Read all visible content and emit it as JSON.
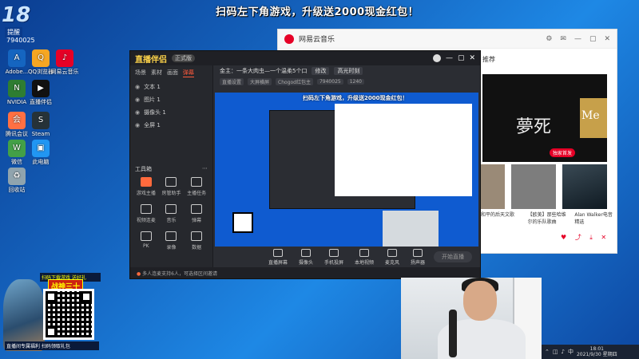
{
  "banner": "扫码左下角游戏，升级送2000现金红包！",
  "streamer": {
    "logo_text": "18",
    "sub": "提醒",
    "uid": "7940025"
  },
  "desktop_icons": [
    {
      "label": "Adobe...",
      "color": "#1565c0",
      "glyph": "A"
    },
    {
      "label": "QQ浏览器",
      "color": "#f5a623",
      "glyph": "Q"
    },
    {
      "label": "网易云音乐",
      "color": "#e60026",
      "glyph": "♪"
    },
    {
      "label": "NVIDIA",
      "color": "#2e7d32",
      "glyph": "N"
    },
    {
      "label": "直播伴侣",
      "color": "#111",
      "glyph": "▶"
    },
    {
      "label": "腾讯会议",
      "color": "#ff7043",
      "glyph": "会"
    },
    {
      "label": "Steam",
      "color": "#263238",
      "glyph": "S"
    },
    {
      "label": "微信",
      "color": "#43a047",
      "glyph": "W"
    },
    {
      "label": "此电脑",
      "color": "#2196f3",
      "glyph": "▣"
    },
    {
      "label": "回收站",
      "color": "#90a4ae",
      "glyph": "♻"
    }
  ],
  "promo": {
    "top_text": "扫码下载游戏 送好礼",
    "game_name": "战神三十",
    "bottom_text": "直播间专属福利 扫码领取礼包"
  },
  "live_app": {
    "brand": "直播伴侣",
    "version": "正式版",
    "tabs": [
      "场景",
      "素材",
      "画面",
      "弹幕"
    ],
    "active_tab": "弹幕",
    "sources": [
      {
        "label": "文本 1"
      },
      {
        "label": "图片 1"
      },
      {
        "label": "摄像头 1"
      },
      {
        "label": "全屏 1"
      }
    ],
    "tools_header": "工具箱",
    "tools": [
      {
        "label": "游戏主播"
      },
      {
        "label": "房管助手"
      },
      {
        "label": "主播任务"
      },
      {
        "label": "视频连麦"
      },
      {
        "label": "音乐"
      },
      {
        "label": "弹幕"
      },
      {
        "label": "PK"
      },
      {
        "label": "录像"
      },
      {
        "label": "数据"
      }
    ],
    "top_title": "金主：一条大肉虫—一个温柔5个口",
    "edit": "修改",
    "category": "高光时刻",
    "row2": [
      "直播设置",
      "大屏横屏",
      "Chogod红包主",
      "7940025",
      "1240"
    ],
    "bottom_tools": [
      "直播屏幕",
      "摄像头",
      "手机投屏",
      "本地视频",
      "麦克风",
      "扬声器"
    ],
    "start_label": "开始直播",
    "status_text": "多人连麦支持6人，可选择区间邀请"
  },
  "music": {
    "title": "网易云音乐",
    "section": "推荐",
    "banner_name": "夢死",
    "banner_me": "Me",
    "banner_tag": "独家首发",
    "captions": [
      "和平的后天文歌",
      "【欧美】那些哈维尔的乐队歌曲",
      "Alan Walker电音精选"
    ]
  },
  "tray": {
    "time": "18:01",
    "date": "2021/9/30 星期四"
  }
}
